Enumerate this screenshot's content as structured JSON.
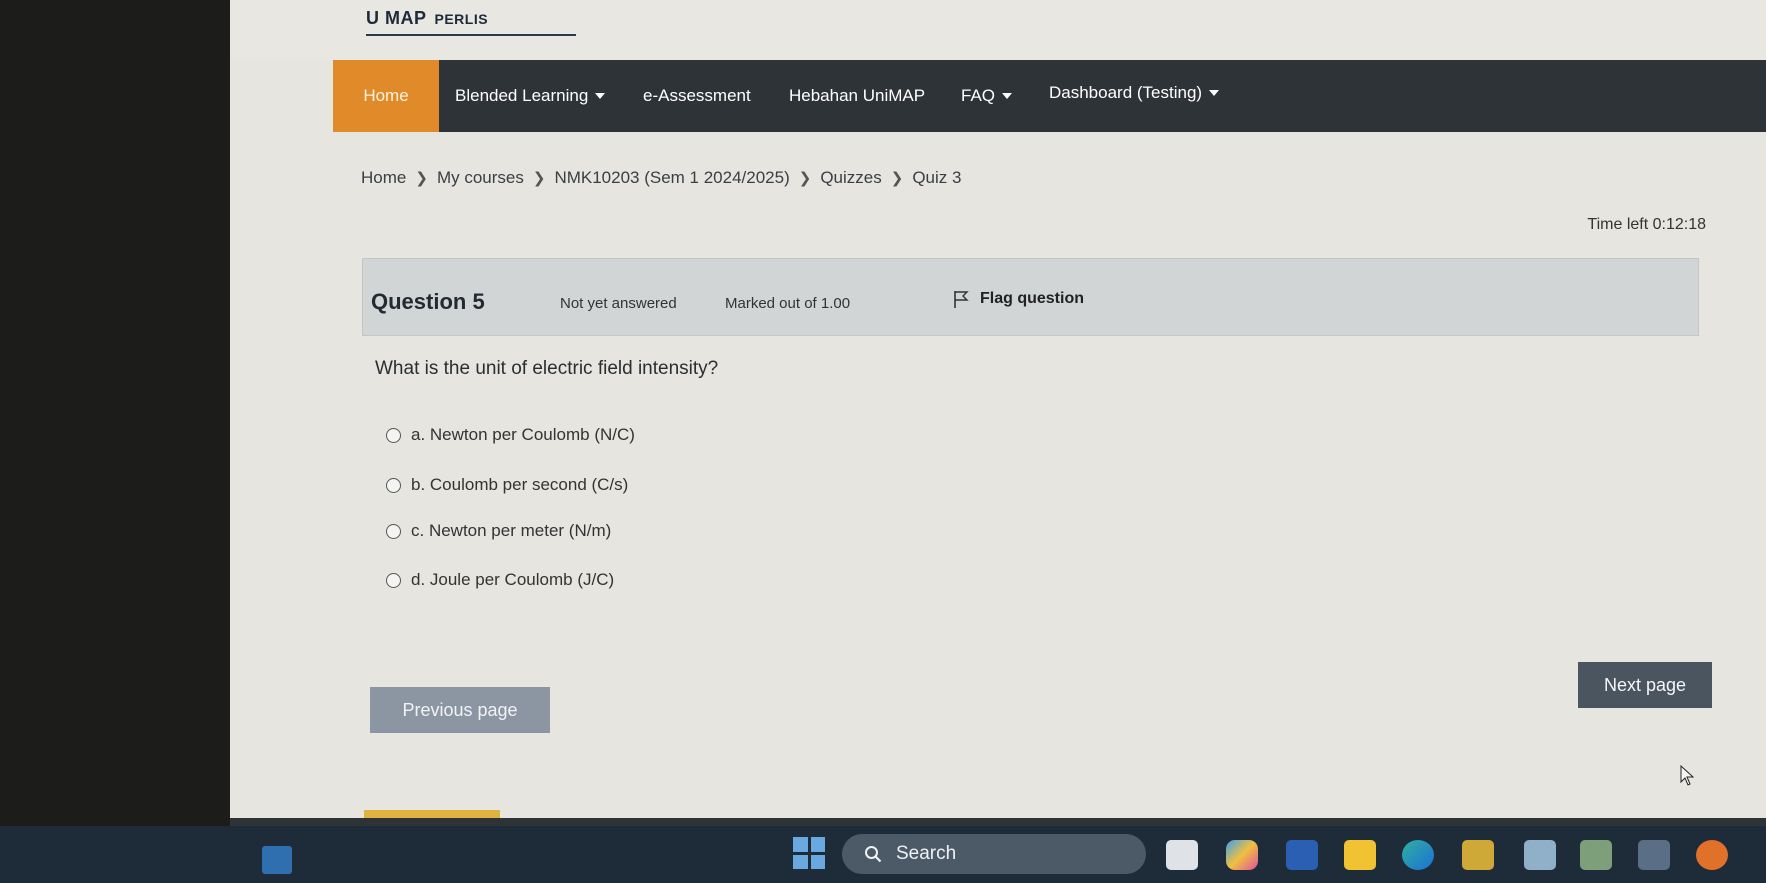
{
  "site": {
    "logo_text": "U MAP",
    "logo_sub": "PERLIS"
  },
  "nav": {
    "items": [
      {
        "label": "Home",
        "active": true,
        "has_dropdown": false
      },
      {
        "label": "Blended Learning",
        "active": false,
        "has_dropdown": true
      },
      {
        "label": "e-Assessment",
        "active": false,
        "has_dropdown": false
      },
      {
        "label": "Hebahan UniMAP",
        "active": false,
        "has_dropdown": false
      },
      {
        "label": "FAQ",
        "active": false,
        "has_dropdown": true
      },
      {
        "label": "Dashboard (Testing)",
        "active": false,
        "has_dropdown": true
      }
    ],
    "active_color": "#e08a2a"
  },
  "breadcrumb": [
    "Home",
    "My courses",
    "NMK10203 (Sem 1 2024/2025)",
    "Quizzes",
    "Quiz 3"
  ],
  "timer": {
    "text": "Time left 0:12:18"
  },
  "question": {
    "number_label": "Question 5",
    "state": "Not yet answered",
    "marks": "Marked out of 1.00",
    "flag_label": "Flag question",
    "text": "What is the unit of electric field intensity?",
    "options": [
      "a. Newton per Coulomb (N/C)",
      "b. Coulomb per second (C/s)",
      "c. Newton per meter (N/m)",
      "d. Joule per Coulomb (J/C)"
    ]
  },
  "navigation": {
    "prev_label": "Previous page",
    "next_label": "Next page"
  },
  "taskbar": {
    "search_label": "Search",
    "apps": [
      "start-icon",
      "files-icon",
      "copilot-icon",
      "word-icon",
      "file-explorer-icon",
      "edge-icon",
      "store-icon",
      "app-icon-1",
      "app-icon-2",
      "app-icon-3",
      "ea-icon"
    ]
  }
}
